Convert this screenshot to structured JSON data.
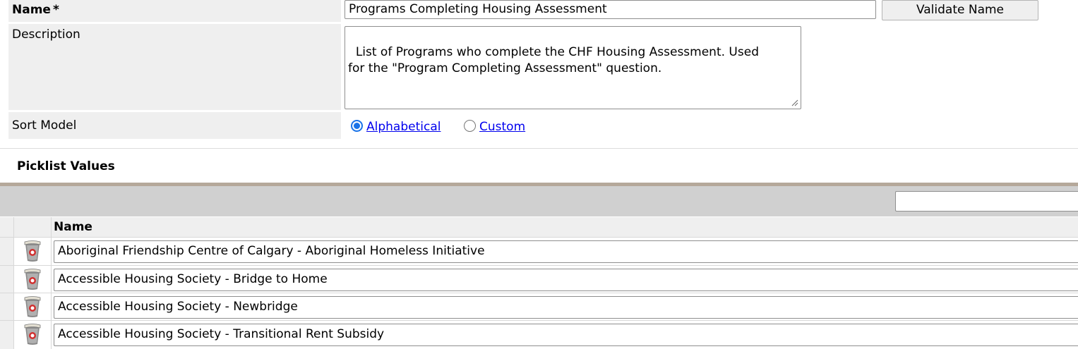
{
  "form": {
    "name_label": "Name",
    "required_marker": "*",
    "name_value": "Programs Completing Housing Assessment",
    "validate_button": "Validate Name",
    "description_label": "Description",
    "description_value": "List of Programs who complete the CHF Housing Assessment. Used\nfor the \"Program Completing Assessment\" question.",
    "sort_model_label": "Sort Model",
    "sort_options": [
      {
        "label": "Alphabetical",
        "selected": true
      },
      {
        "label": "Custom",
        "selected": false
      }
    ]
  },
  "picklist": {
    "section_title": "Picklist Values",
    "filter_value": "",
    "column_header": "Name",
    "rows": [
      {
        "name": "Aboriginal Friendship Centre of Calgary - Aboriginal Homeless Initiative"
      },
      {
        "name": "Accessible Housing Society - Bridge to Home"
      },
      {
        "name": "Accessible Housing Society - Newbridge"
      },
      {
        "name": "Accessible Housing Society - Transitional Rent Subsidy"
      }
    ]
  },
  "colors": {
    "label_bg": "#efefef",
    "header_band": "#d0d0d0",
    "section_rule": "#b5a89a",
    "link": "#0000ee",
    "radio_accent": "#1a73e8"
  },
  "icons": {
    "row_delete": "trash-can-icon"
  }
}
